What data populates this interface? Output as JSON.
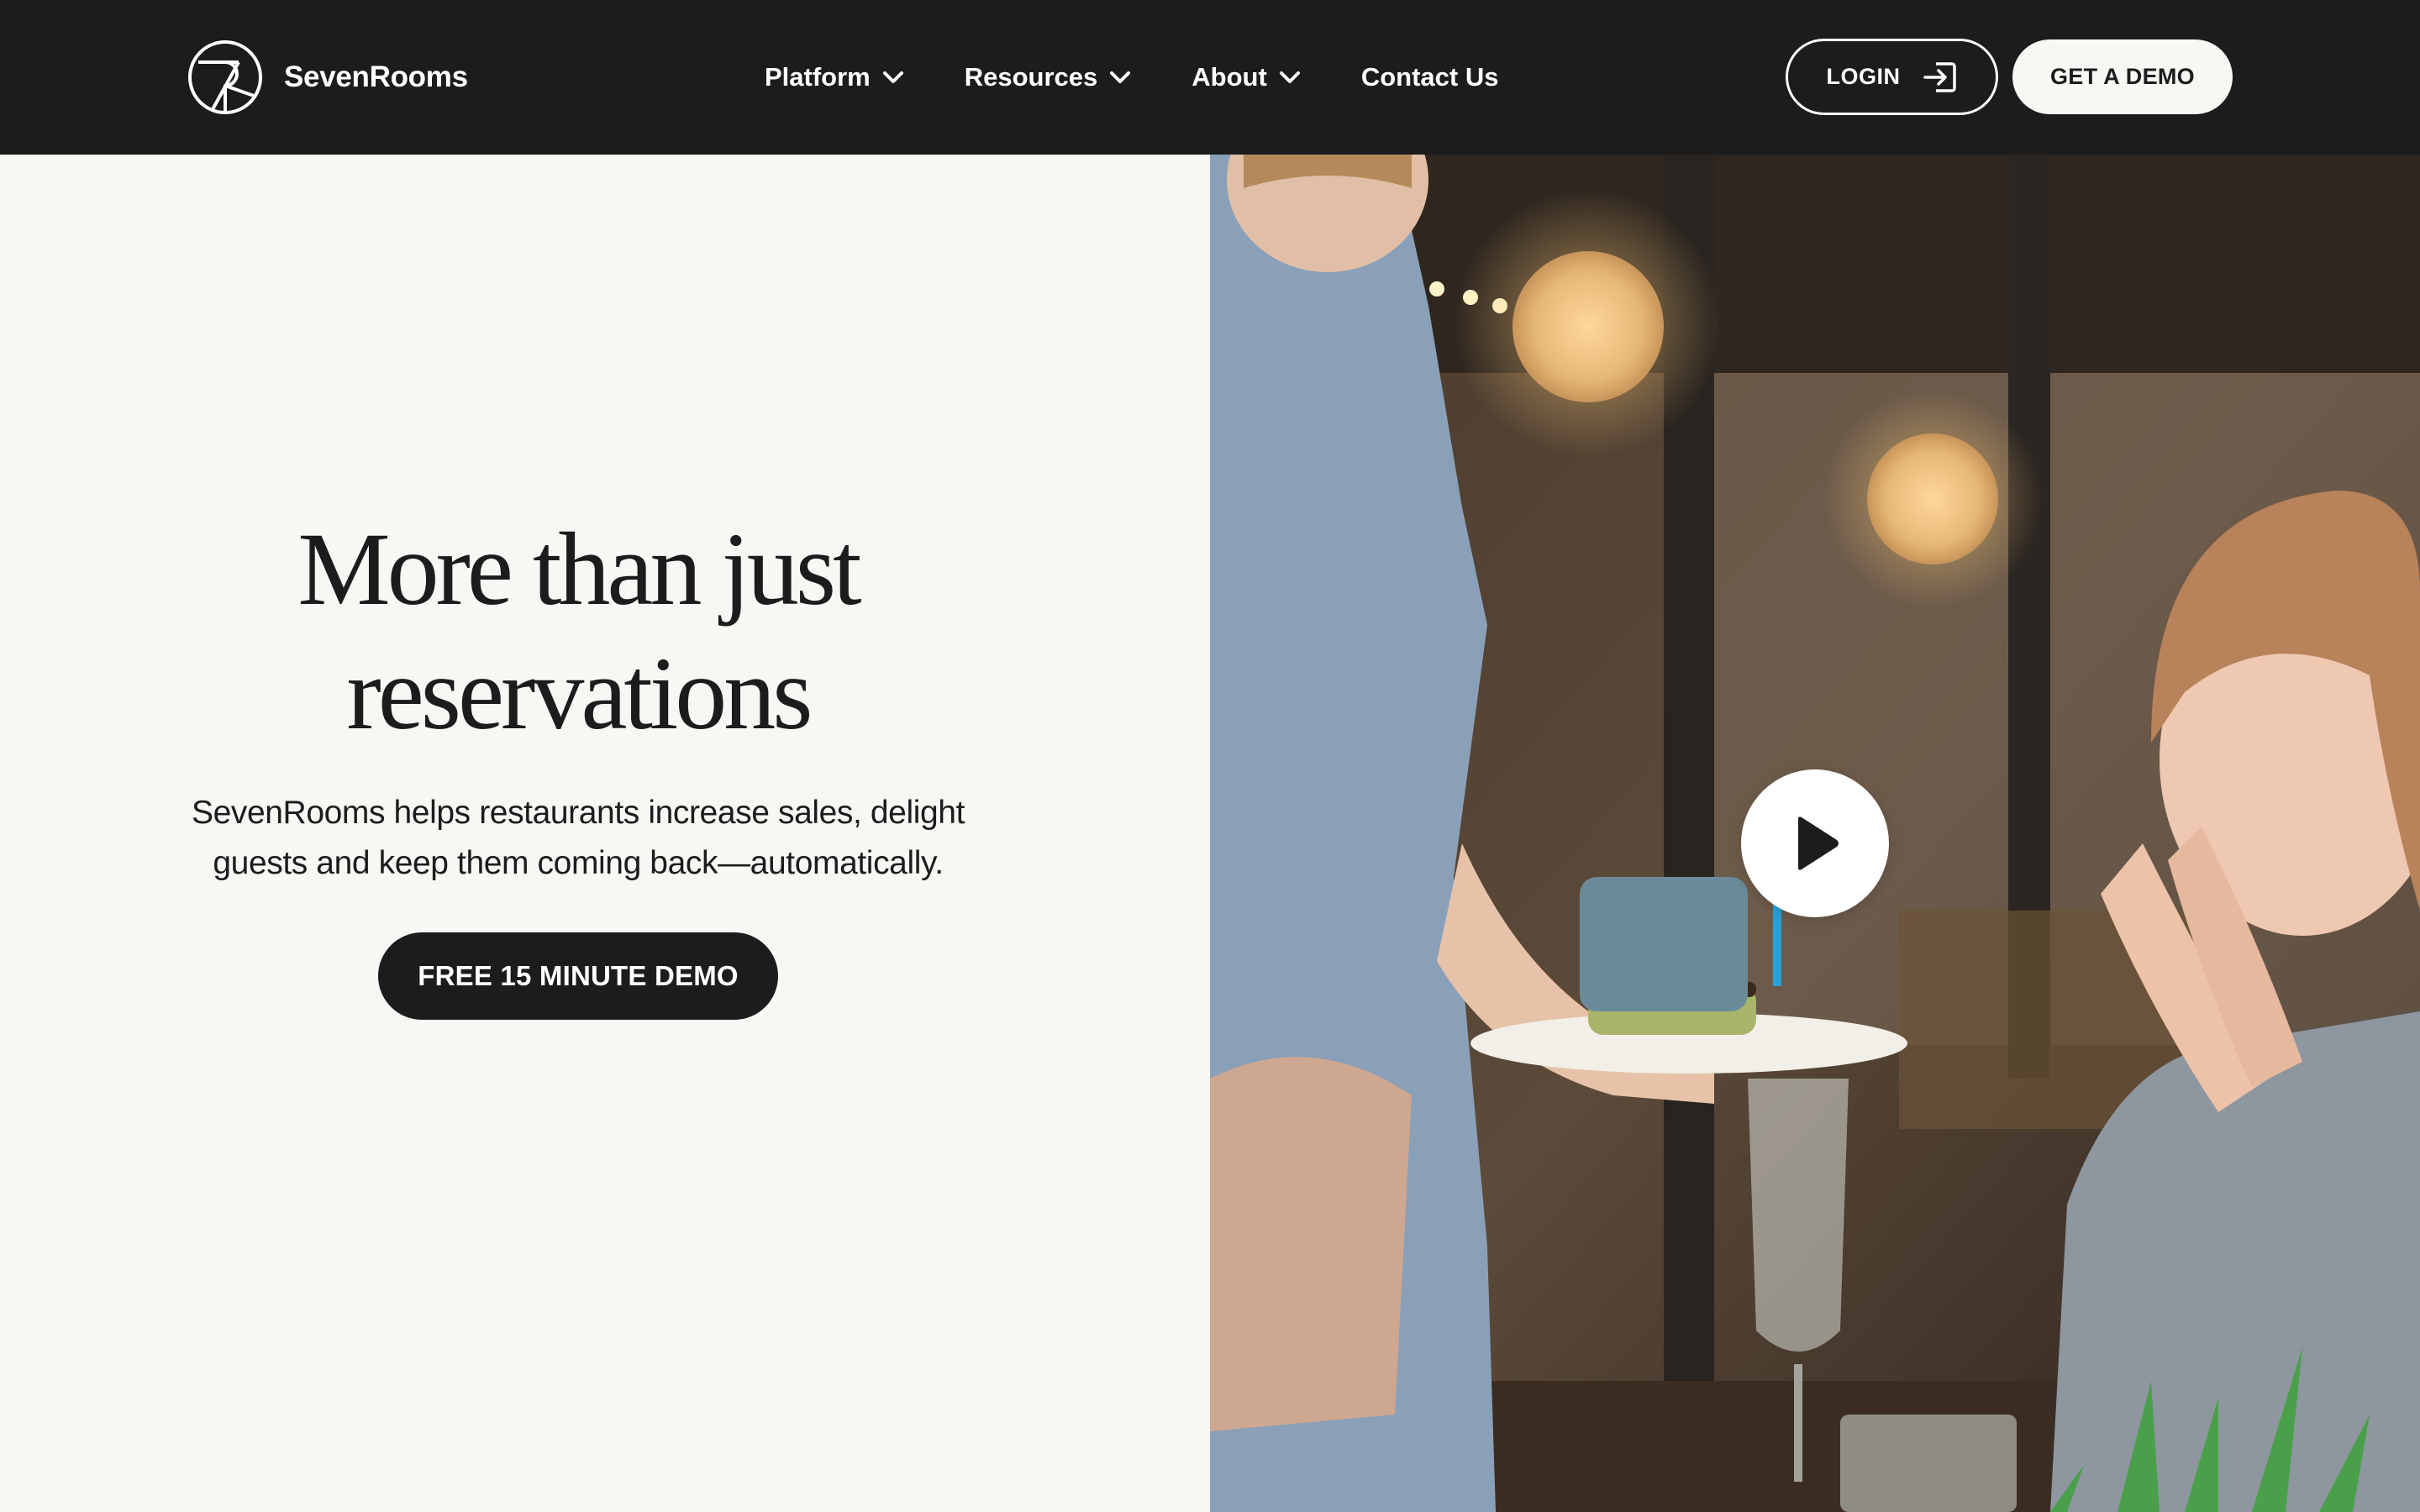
{
  "brand": {
    "name": "SevenRooms",
    "logo_icon": "sevenrooms-logo-icon"
  },
  "nav": {
    "items": [
      {
        "label": "Platform",
        "has_dropdown": true
      },
      {
        "label": "Resources",
        "has_dropdown": true
      },
      {
        "label": "About",
        "has_dropdown": true
      },
      {
        "label": "Contact Us",
        "has_dropdown": false
      }
    ],
    "login_label": "LOGIN",
    "login_icon": "sign-in-icon",
    "demo_label": "GET A DEMO"
  },
  "hero": {
    "headline_line1": "More than just",
    "headline_line2": "reservations",
    "subhead_line1": "SevenRooms helps restaurants increase sales, delight",
    "subhead_line2": "guests and keep them coming back—automatically.",
    "cta_label": "FREE 15 MINUTE DEMO"
  },
  "video": {
    "play_icon": "play-icon"
  },
  "colors": {
    "nav_bg": "#1c1c1c",
    "page_bg": "#f8f7f4",
    "text": "#1c1c1c",
    "accent_light": "#f8f7f4"
  }
}
